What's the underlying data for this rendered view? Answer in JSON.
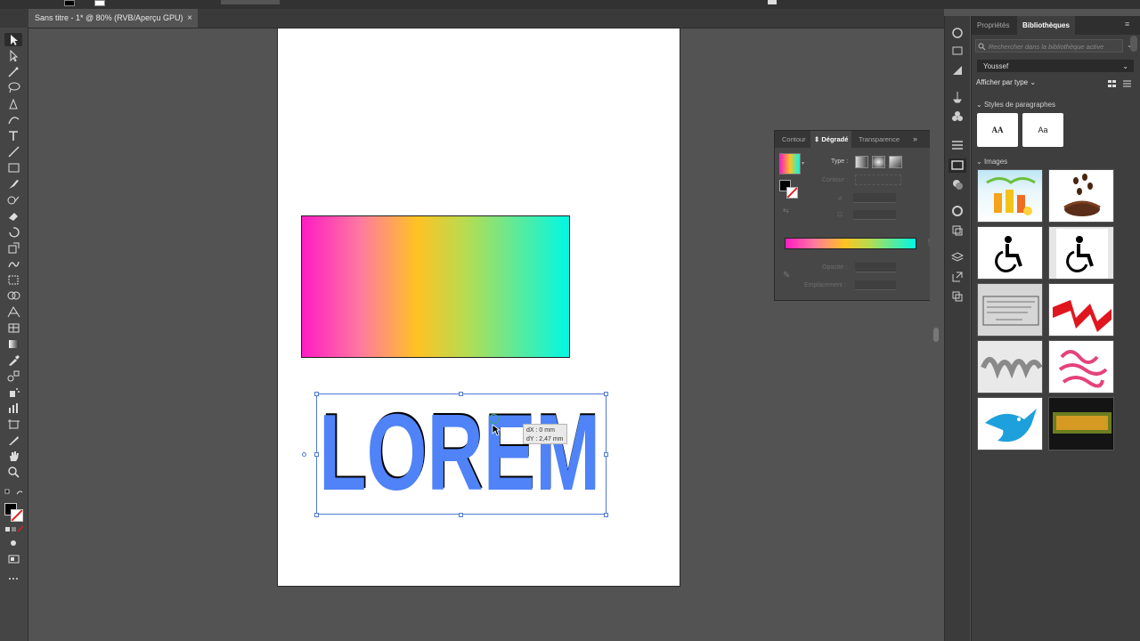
{
  "document": {
    "tab_title": "Sans titre - 1* @ 80% (RVB/Aperçu GPU)",
    "close_glyph": "×"
  },
  "artwork": {
    "text_object": "LOREM",
    "gradient_colors": [
      "#ff1cc3",
      "#ffc223",
      "#00f8e5"
    ],
    "text_fill": "#4f83f7"
  },
  "move_tooltip": {
    "dx": "dX : 0 mm",
    "dy": "dY : 2,47 mm"
  },
  "gradient_panel": {
    "tabs": [
      "Contour",
      "Dégradé",
      "Transparence"
    ],
    "active_tab": "Dégradé",
    "type_label": "Type :",
    "contour_label": "Contour :",
    "opacity_label": "Opacité :",
    "location_label": "Emplacement :"
  },
  "library_panel": {
    "tabs": [
      "Propriétés",
      "Bibliothèques"
    ],
    "active_tab": "Bibliothèques",
    "search_placeholder": "Rechercher dans la bibliothèque active",
    "library_name": "Youssef",
    "view_by_label": "Afficher par type",
    "paragraph_styles_label": "Styles de paragraphes",
    "paragraph_styles": [
      "AA",
      "Aa"
    ],
    "images_label": "Images",
    "image_thumbs": [
      "juice-bottles",
      "coffee-beans-splash",
      "wheelchair-symbol",
      "wheelchair-symbol-framed",
      "business-stamp",
      "red-ribbon",
      "metal-wave",
      "live-laugh-love",
      "blue-bird-logo",
      "youssef-3d-text"
    ]
  },
  "colors": {
    "ui_dark": "#323232",
    "ui_panel": "#3e3e3e",
    "canvas_bg": "#535353",
    "selection": "#4f7bd7"
  }
}
